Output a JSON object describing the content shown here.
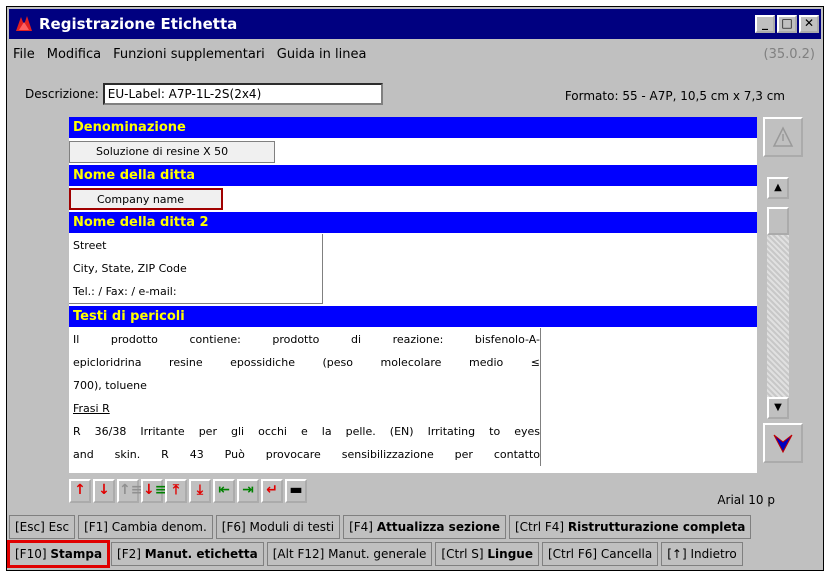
{
  "window": {
    "title": "Registrazione Etichetta",
    "controls": [
      "_",
      "□",
      "✕"
    ]
  },
  "menu": {
    "items": [
      "File",
      "Modifica",
      "Funzioni supplementari",
      "Guida in linea"
    ],
    "version": "(35.0.2)"
  },
  "form": {
    "descrizione_label": "Descrizione:",
    "descrizione_value": "EU-Label: A7P-1L-2S(2x4)",
    "formato": "Formato: 55 - A7P, 10,5 cm x 7,3 cm"
  },
  "sections": {
    "denominazione": {
      "header": "Denominazione",
      "value": "Soluzione di resine X 50"
    },
    "ditta": {
      "header": "Nome della ditta",
      "value": "Company name"
    },
    "ditta2": {
      "header": "Nome della ditta 2",
      "lines": [
        "Street",
        "City, State, ZIP Code",
        "Tel.: / Fax: / e-mail:"
      ]
    },
    "pericoli": {
      "header": "Testi di pericoli",
      "lines": [
        "Il prodotto contiene: prodotto di reazione: bisfenolo-A-",
        "epicloridrina resine epossidiche (peso molecolare medio ≤",
        "700), toluene",
        "Frasi R",
        "R 36/38 Irritante per gli occhi e la pelle. (EN) Irritating to eyes",
        "and skin. R 43 Può provocare sensibilizzazione per contatto"
      ]
    }
  },
  "font_label": "Arial 10 p",
  "keys_row1": [
    {
      "key": "[Esc]",
      "label": "Esc"
    },
    {
      "key": "[F1]",
      "label": "Cambia denom."
    },
    {
      "key": "[F6]",
      "label": "Moduli di testi"
    },
    {
      "key": "[F4]",
      "label": "Attualizza sezione"
    },
    {
      "key": "[Ctrl F4]",
      "label": "Ristrutturazione completa"
    }
  ],
  "keys_row2": [
    {
      "key": "[F10]",
      "label": "Stampa"
    },
    {
      "key": "[F2]",
      "label": "Manut. etichetta"
    },
    {
      "key": "[Alt F12]",
      "label": "Manut. generale"
    },
    {
      "key": "[Ctrl S]",
      "label": "Lingue"
    },
    {
      "key": "[Ctrl F6]",
      "label": "Cancella"
    },
    {
      "key": "[↑]",
      "label": "Indietro"
    }
  ],
  "colors": {
    "titlebar": "#000080",
    "section_header_bg": "#0000ff",
    "section_header_text": "#ffff00",
    "highlight": "#e00000"
  }
}
